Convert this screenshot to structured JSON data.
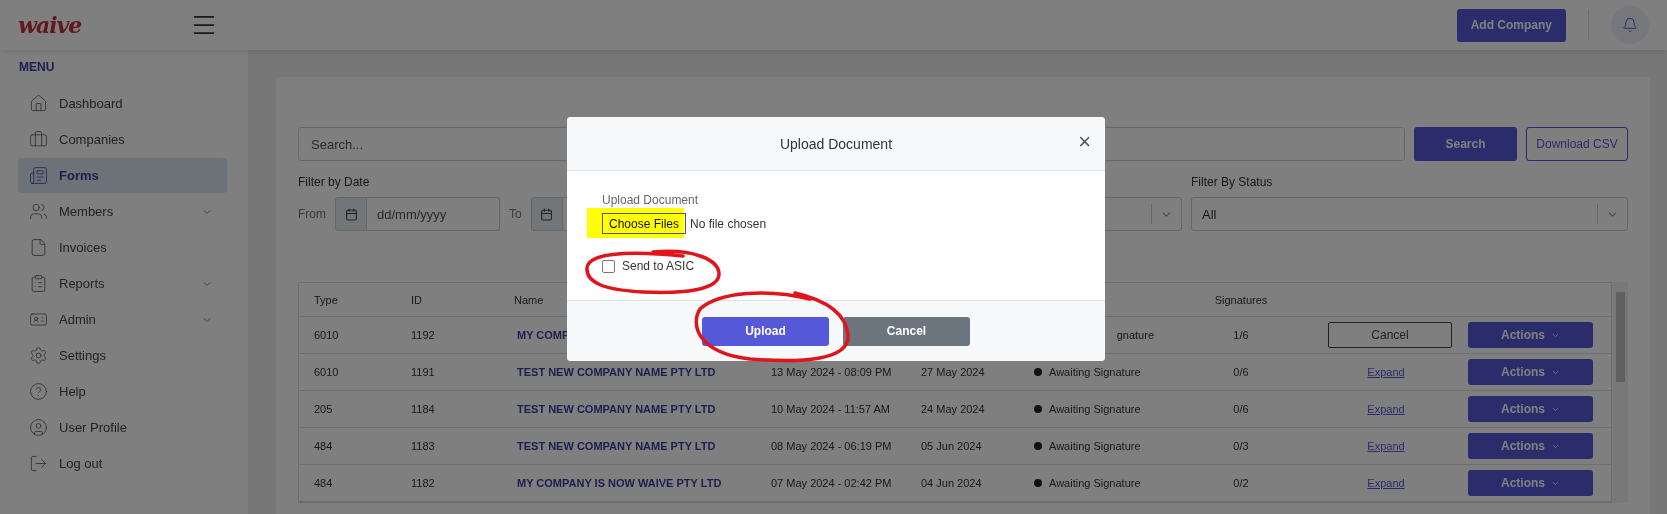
{
  "brand": {
    "logo": "waive"
  },
  "header": {
    "add_button": "Add Company"
  },
  "sidebar": {
    "heading": "MENU",
    "items": [
      {
        "label": "Dashboard",
        "selected": false,
        "expandable": false
      },
      {
        "label": "Companies",
        "selected": false,
        "expandable": false
      },
      {
        "label": "Forms",
        "selected": true,
        "expandable": false
      },
      {
        "label": "Members",
        "selected": false,
        "expandable": true
      },
      {
        "label": "Invoices",
        "selected": false,
        "expandable": false
      },
      {
        "label": "Reports",
        "selected": false,
        "expandable": true
      },
      {
        "label": "Admin",
        "selected": false,
        "expandable": true
      },
      {
        "label": "Settings",
        "selected": false,
        "expandable": false
      },
      {
        "label": "Help",
        "selected": false,
        "expandable": false
      },
      {
        "label": "User Profile",
        "selected": false,
        "expandable": false
      },
      {
        "label": "Log out",
        "selected": false,
        "expandable": false
      }
    ]
  },
  "search": {
    "placeholder": "Search...",
    "button": "Search",
    "csv_button": "Download CSV"
  },
  "filters": {
    "date_label": "Filter by Date",
    "from": "From",
    "to": "To",
    "date_placeholder": "dd/mm/yyyy",
    "status_label": "Filter By Status",
    "status_value": "All"
  },
  "table": {
    "columns": {
      "type": "Type",
      "id": "ID",
      "name": "Name",
      "signatures": "Signatures"
    },
    "rows": [
      {
        "type": "6010",
        "id": "1192",
        "name": "MY COMP",
        "status": "gnature",
        "signatures": "1/6",
        "action": {
          "kind": "cancel",
          "label": "Cancel"
        },
        "actions_label": "Actions"
      },
      {
        "type": "6010",
        "id": "1191",
        "name": "TEST NEW COMPANY NAME PTY LTD",
        "created": "13 May 2024 - 08:09 PM",
        "due": "27 May 2024",
        "status": "Awaiting Signature",
        "dot": true,
        "signatures": "0/6",
        "action": {
          "kind": "link",
          "label": "Expand"
        },
        "actions_label": "Actions"
      },
      {
        "type": "205",
        "id": "1184",
        "name": "TEST NEW COMPANY NAME PTY LTD",
        "created": "10 May 2024 - 11:57 AM",
        "due": "24 May 2024",
        "status": "Awaiting Signature",
        "dot": true,
        "signatures": "0/6",
        "action": {
          "kind": "link",
          "label": "Expand"
        },
        "actions_label": "Actions"
      },
      {
        "type": "484",
        "id": "1183",
        "name": "TEST NEW COMPANY NAME PTY LTD",
        "created": "08 May 2024 - 06:19 PM",
        "due": "05 Jun 2024",
        "status": "Awaiting Signature",
        "dot": true,
        "signatures": "0/3",
        "action": {
          "kind": "link",
          "label": "Expand"
        },
        "actions_label": "Actions"
      },
      {
        "type": "484",
        "id": "1182",
        "name": "MY COMPANY IS NOW WAIVE PTY LTD",
        "created": "07 May 2024 - 02:42 PM",
        "due": "04 Jun 2024",
        "status": "Awaiting Signature",
        "dot": true,
        "signatures": "0/2",
        "action": {
          "kind": "link",
          "label": "Expand"
        },
        "actions_label": "Actions"
      }
    ]
  },
  "modal": {
    "title": "Upload Document",
    "close": "×",
    "field_label": "Upload Document",
    "file_button": "Choose Files",
    "file_status": "No file chosen",
    "checkbox": {
      "label": "Send to ASIC",
      "checked": false
    },
    "buttons": [
      {
        "label": "Upload",
        "kind": "primary"
      },
      {
        "label": "Cancel",
        "kind": "secondary"
      }
    ]
  }
}
